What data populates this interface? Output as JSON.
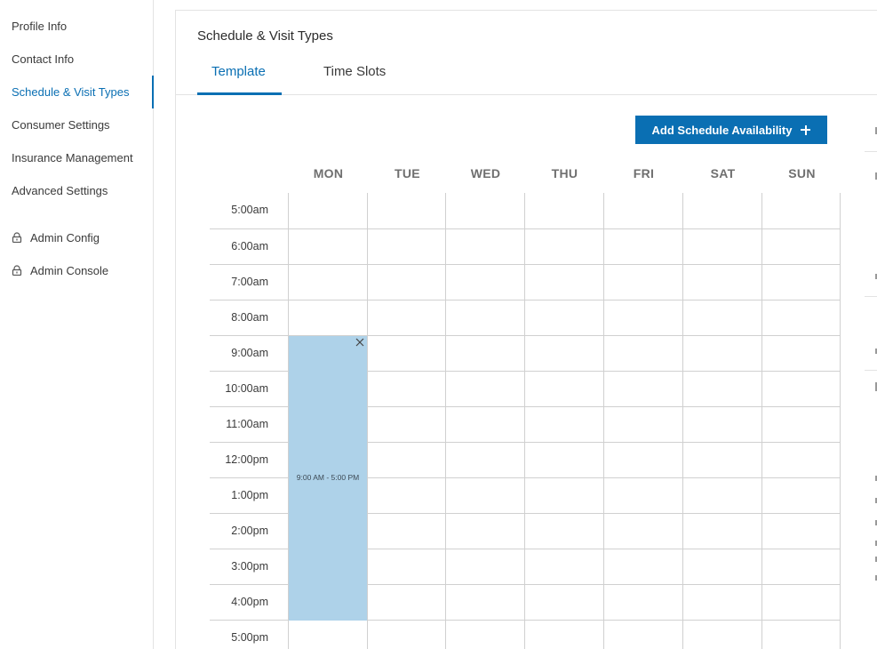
{
  "sidebar": {
    "items": [
      {
        "label": "Profile Info"
      },
      {
        "label": "Contact Info"
      },
      {
        "label": "Schedule & Visit Types"
      },
      {
        "label": "Consumer Settings"
      },
      {
        "label": "Insurance Management"
      },
      {
        "label": "Advanced Settings"
      },
      {
        "label": "Admin Config"
      },
      {
        "label": "Admin Console"
      }
    ]
  },
  "main": {
    "title": "Schedule & Visit Types",
    "tabs": [
      {
        "label": "Template"
      },
      {
        "label": "Time Slots"
      }
    ],
    "add_button": "Add Schedule Availability"
  },
  "calendar": {
    "days": [
      "MON",
      "TUE",
      "WED",
      "THU",
      "FRI",
      "SAT",
      "SUN"
    ],
    "times": [
      "5:00am",
      "6:00am",
      "7:00am",
      "8:00am",
      "9:00am",
      "10:00am",
      "11:00am",
      "12:00pm",
      "1:00pm",
      "2:00pm",
      "3:00pm",
      "4:00pm",
      "5:00pm"
    ],
    "availability": {
      "day": "MON",
      "label": "9:00 AM - 5:00 PM",
      "color": "#aed2e9"
    }
  },
  "colors": {
    "accent": "#0a6fb3",
    "block": "#aed2e9"
  }
}
